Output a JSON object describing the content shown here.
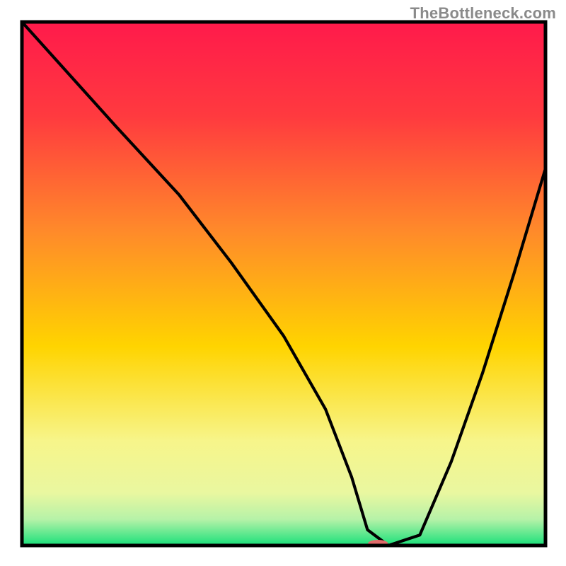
{
  "watermark": {
    "text": "TheBottleneck.com"
  },
  "chart_data": {
    "type": "line",
    "title": "",
    "xlabel": "",
    "ylabel": "",
    "xlim": [
      0,
      100
    ],
    "ylim": [
      0,
      100
    ],
    "background_gradient": {
      "top": "#ff1a4b",
      "mid_upper": "#ff8a2a",
      "mid": "#ffd400",
      "mid_lower": "#f7f58a",
      "bottom": "#19e07a"
    },
    "series": [
      {
        "name": "bottleneck-curve",
        "x": [
          0,
          18,
          30,
          40,
          50,
          58,
          63,
          66,
          70,
          76,
          82,
          88,
          94,
          100
        ],
        "y": [
          100,
          80,
          67,
          54,
          40,
          26,
          13,
          3,
          0,
          2,
          16,
          33,
          52,
          72
        ]
      }
    ],
    "markers": [
      {
        "name": "optimal-point",
        "x": 68,
        "y": 0.4,
        "color": "#e06a6a",
        "rx": 14,
        "ry": 5
      }
    ],
    "axes": {
      "border_color": "#000000",
      "border_width": 4
    }
  }
}
